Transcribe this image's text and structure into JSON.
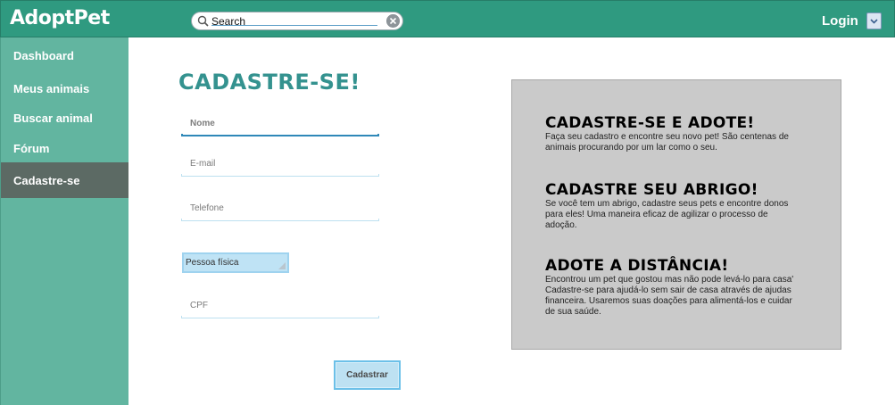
{
  "app": {
    "name": "AdoptPet"
  },
  "header": {
    "search_placeholder": "Search",
    "search_value": "Search",
    "login_label": "Login"
  },
  "sidebar": {
    "items": [
      {
        "label": "Dashboard"
      },
      {
        "label": "Meus animais"
      },
      {
        "label": "Buscar animal"
      },
      {
        "label": "Fórum"
      },
      {
        "label": "Cadastre-se",
        "active": true
      }
    ]
  },
  "form": {
    "title": "CADASTRE-SE!",
    "fields": [
      {
        "label": "Nome",
        "value": ""
      },
      {
        "label": "E-mail",
        "value": ""
      },
      {
        "label": "Telefone",
        "value": ""
      },
      {
        "label": "CPF",
        "value": ""
      }
    ],
    "person_type": {
      "selected": "Pessoa física"
    },
    "submit_label": "Cadastrar"
  },
  "info": {
    "sections": [
      {
        "heading": "CADASTRE-SE E ADOTE!",
        "lines": [
          "Faça seu cadastro e encontre seu novo pet! São centenas de",
          "animais procurando por um lar como o seu."
        ]
      },
      {
        "heading": "CADASTRE SEU ABRIGO!",
        "lines": [
          "Se você tem um abrigo, cadastre seus pets e encontre donos",
          "para eles! Uma maneira eficaz de agilizar o processo de",
          "adoção."
        ]
      },
      {
        "heading": "ADOTE A DISTÂNCIA!",
        "lines": [
          "Encontrou um pet que gostou mas não pode levá-lo para casa'",
          "Cadastre-se para ajudá-lo sem sair de casa através de ajudas",
          "financeira. Usaremos suas doações para alimentá-los e cuidar",
          "de sua saúde."
        ]
      }
    ]
  },
  "colors": {
    "topbar": "#2f9a80",
    "sidebar": "#62b5a0",
    "sidebar_active": "#5c6a64",
    "title": "#34928f",
    "panel": "#cacaca"
  }
}
